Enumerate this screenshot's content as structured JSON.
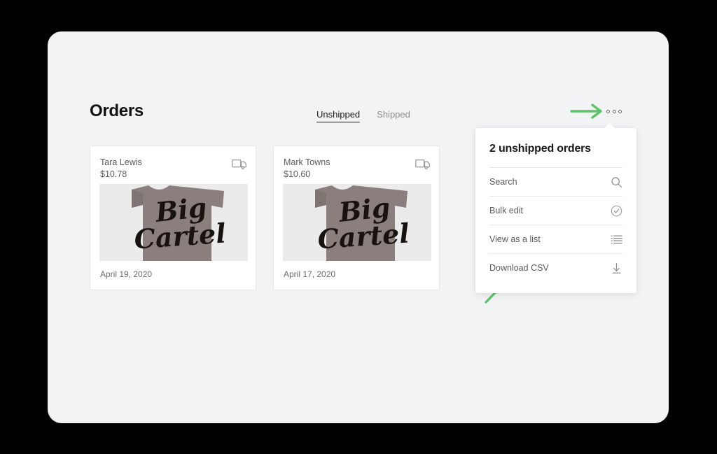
{
  "window": {
    "background_color": "#000000",
    "panel_color": "#f2f3f4"
  },
  "header": {
    "title": "Orders",
    "tabs": [
      {
        "label": "Unshipped",
        "active": true
      },
      {
        "label": "Shipped",
        "active": false
      }
    ],
    "overflow_button": {
      "name": "more-options",
      "icon": "ellipsis-icon"
    }
  },
  "annotations": {
    "arrow_color": "#5ec269",
    "items": [
      {
        "name": "arrow-to-overflow-menu",
        "direction": "right"
      },
      {
        "name": "arrow-to-download-csv",
        "direction": "up-right"
      }
    ]
  },
  "orders": [
    {
      "customer": "Tara Lewis",
      "price": "$10.78",
      "date": "April 19, 2020",
      "status_icon": "truck-icon",
      "product_image": {
        "alt": "Big Cartel t-shirt",
        "shirt_color": "#8a7f7d",
        "background_color": "#ebebeb",
        "print_text": "Big Cartel"
      }
    },
    {
      "customer": "Mark Towns",
      "price": "$10.60",
      "date": "April 17, 2020",
      "status_icon": "truck-icon",
      "product_image": {
        "alt": "Big Cartel t-shirt",
        "shirt_color": "#8a7f7d",
        "background_color": "#ebebeb",
        "print_text": "Big Cartel"
      }
    }
  ],
  "dropdown": {
    "title": "2 unshipped orders",
    "items": [
      {
        "label": "Search",
        "icon": "search-icon"
      },
      {
        "label": "Bulk edit",
        "icon": "check-circle-icon"
      },
      {
        "label": "View as a list",
        "icon": "list-icon"
      },
      {
        "label": "Download CSV",
        "icon": "download-icon"
      }
    ]
  }
}
